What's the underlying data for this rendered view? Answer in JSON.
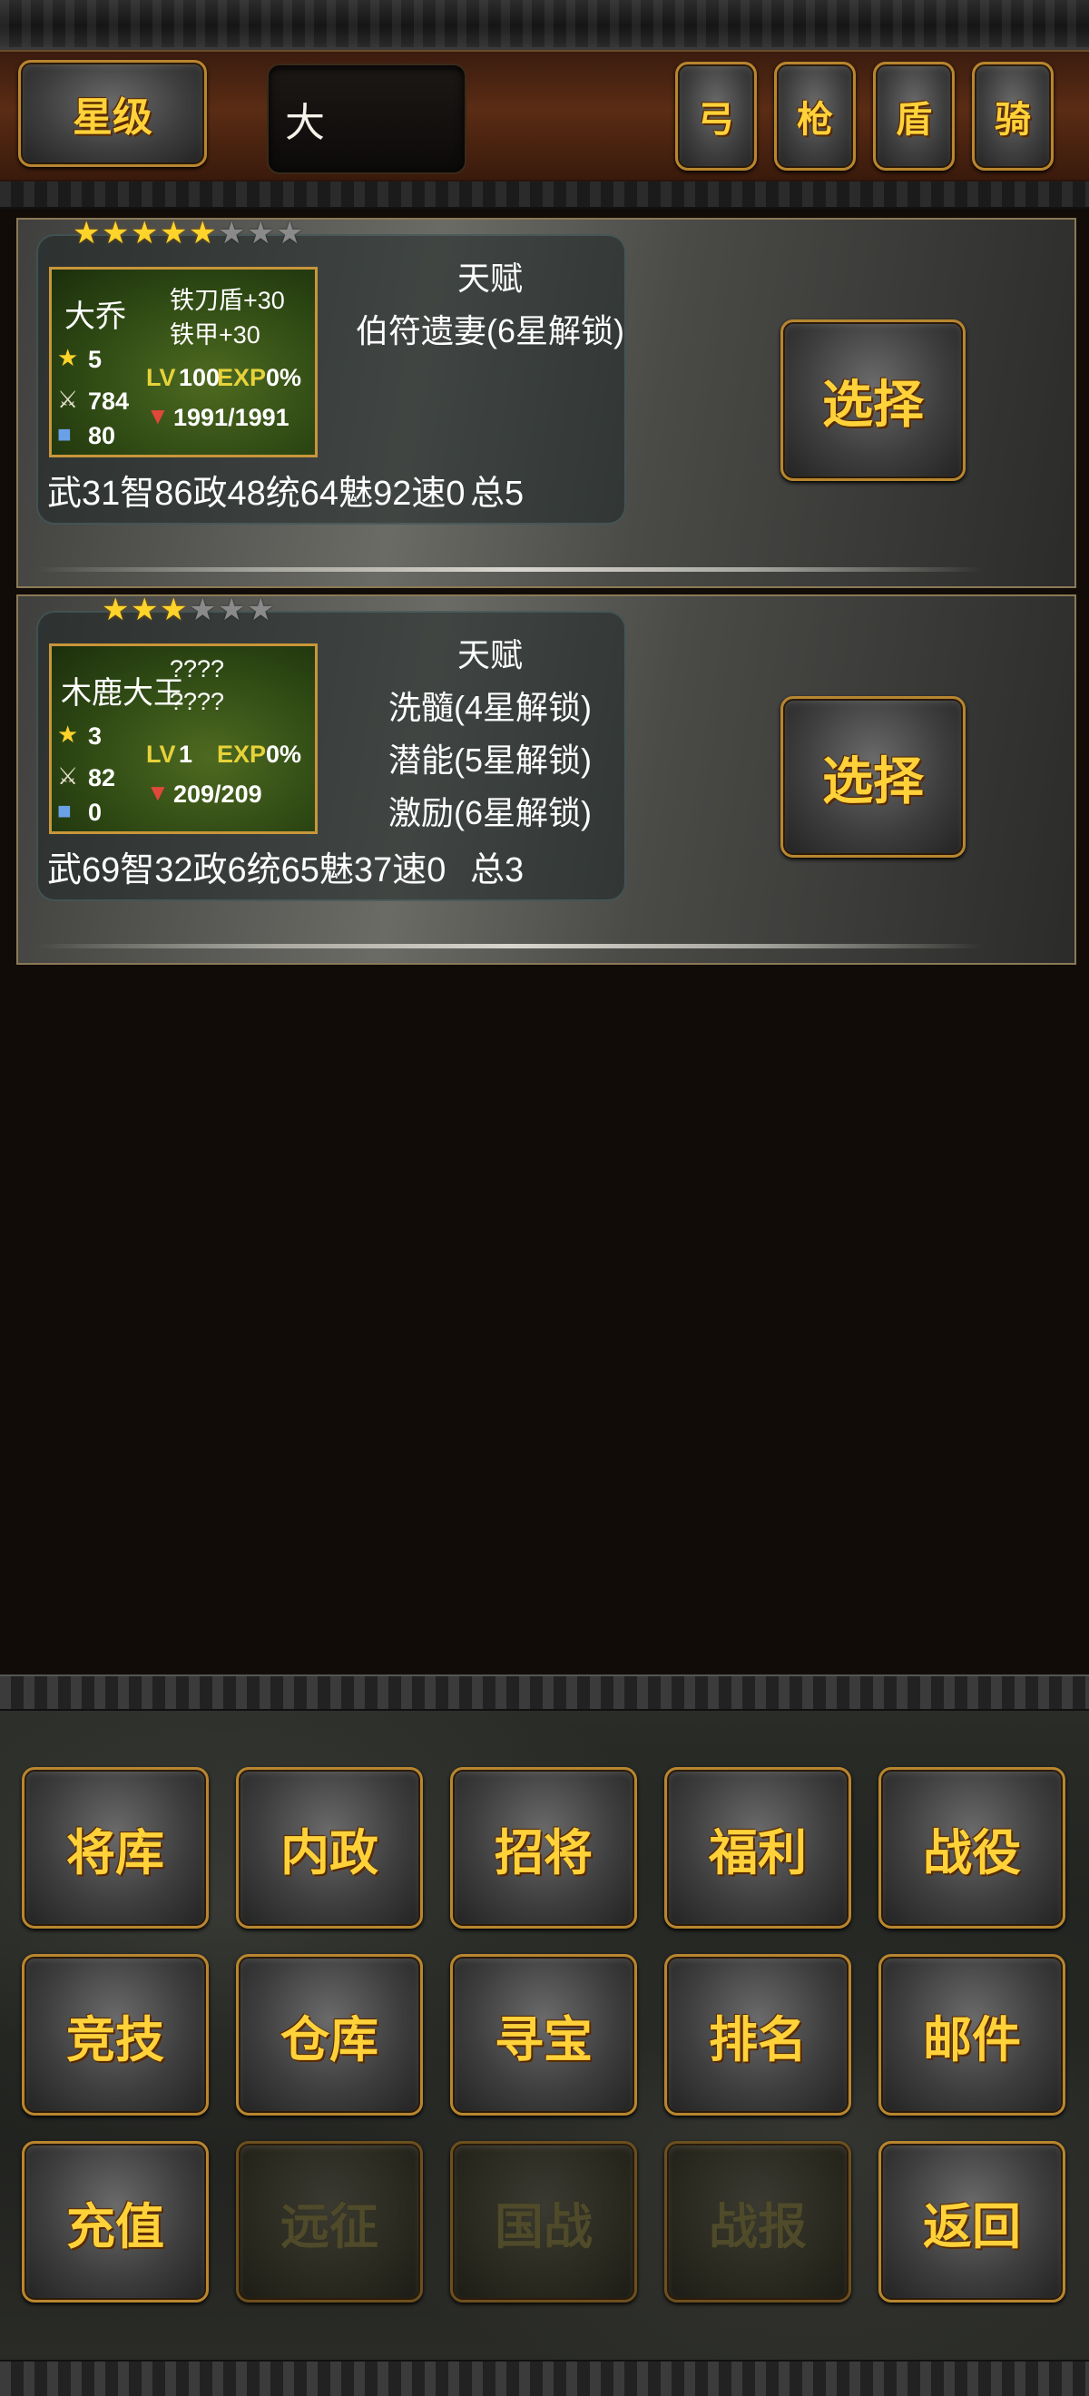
{
  "toolbar": {
    "star_button_label": "星级",
    "search_value": "大",
    "types": [
      "弓",
      "枪",
      "盾",
      "骑"
    ]
  },
  "heroes": [
    {
      "stars_on": 5,
      "stars_total": 8,
      "name": "大乔",
      "equip1": "铁刀盾+30",
      "equip2": "铁甲+30",
      "star_level": "5",
      "lv_label": "LV",
      "lv": "100",
      "exp_label": "EXP",
      "exp": "0%",
      "attack": "784",
      "defense": "80",
      "hp": "1991/1991",
      "stats": "武31智86政48统64魅92速0",
      "total": "总5",
      "talent_title": "天赋",
      "talents": [
        "伯符遗妻(6星解锁)"
      ],
      "select_label": "选择"
    },
    {
      "stars_on": 3,
      "stars_total": 6,
      "name": "木鹿大王",
      "equip1": "????",
      "equip2": "????",
      "star_level": "3",
      "lv_label": "LV",
      "lv": "1",
      "exp_label": "EXP",
      "exp": "0%",
      "attack": "82",
      "defense": "0",
      "hp": "209/209",
      "stats": "武69智32政6统65魅37速0",
      "total": "总3",
      "talent_title": "天赋",
      "talents": [
        "洗髓(4星解锁)",
        "潜能(5星解锁)",
        "激励(6星解锁)"
      ],
      "select_label": "选择"
    }
  ],
  "nav": {
    "row1": [
      "将库",
      "内政",
      "招将",
      "福利",
      "战役"
    ],
    "row2": [
      "竞技",
      "仓库",
      "寻宝",
      "排名",
      "邮件"
    ],
    "row3": [
      "充值",
      "远征",
      "国战",
      "战报",
      "返回"
    ]
  }
}
